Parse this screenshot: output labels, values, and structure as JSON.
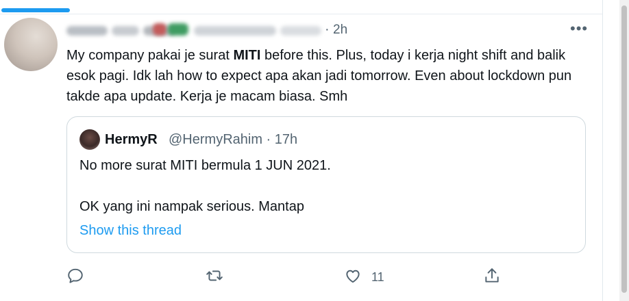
{
  "tweet": {
    "time_sep": "·",
    "time": "2h",
    "more_label": "•••",
    "text_part1": "My company pakai je surat ",
    "text_bold": "MITI",
    "text_part2": " before this. Plus, today i kerja night shift and balik esok pagi. Idk lah how to expect apa akan jadi tomorrow. Even about lockdown pun takde apa update. Kerja je macam biasa. Smh"
  },
  "quote": {
    "name": "HermyR",
    "handle_time": "@HermyRahim · 17h",
    "line1": "No more surat MITI bermula 1 JUN 2021.",
    "line2": "OK yang ini nampak serious. Mantap",
    "link": "Show this thread"
  },
  "actions": {
    "reply_icon": "reply-icon",
    "retweet_icon": "retweet-icon",
    "like_icon": "like-icon",
    "like_count": "11",
    "share_icon": "share-icon"
  },
  "colors": {
    "accent": "#1d9bf0",
    "secondary_text": "#536471",
    "border": "#cfd9de"
  }
}
